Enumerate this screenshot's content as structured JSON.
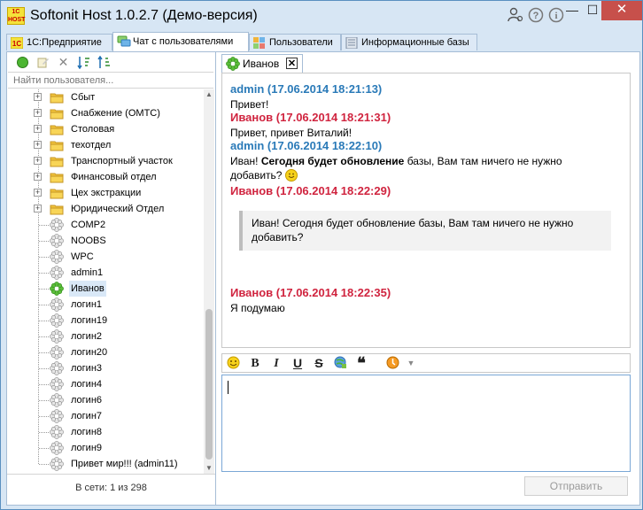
{
  "window": {
    "title": "Softonit Host 1.0.2.7 (Демо-версия)",
    "app_icon_text": "1С HOST",
    "controls": {
      "minimize": "—",
      "maximize": "☐",
      "close": "✕"
    },
    "title_buttons": [
      "user-settings-icon",
      "help-icon",
      "info-icon"
    ]
  },
  "tabs": [
    {
      "label": "1С:Предприятие",
      "icon": "1c-icon"
    },
    {
      "label": "Чат с пользователями",
      "icon": "chat-icon",
      "active": true
    },
    {
      "label": "Пользователи",
      "icon": "users-icon"
    },
    {
      "label": "Информационные базы",
      "icon": "database-icon"
    }
  ],
  "sidebar": {
    "search_placeholder": "Найти пользователя...",
    "toolbar_icons": [
      "online-status-icon",
      "edit-icon",
      "delete-icon",
      "sort-icon",
      "sort-alt-icon"
    ],
    "folders": [
      "Сбыт",
      "Снабжение (ОМТС)",
      "Столовая",
      "техотдел",
      "Транспортный участок",
      "Финансовый отдел",
      "Цех экстракции",
      "Юридический Отдел"
    ],
    "users": [
      {
        "name": "COMP2",
        "online": false
      },
      {
        "name": "NOOBS",
        "online": false
      },
      {
        "name": "WPC",
        "online": false
      },
      {
        "name": "admin1",
        "online": false
      },
      {
        "name": "Иванов",
        "online": true,
        "selected": true
      },
      {
        "name": "логин1",
        "online": false
      },
      {
        "name": "логин19",
        "online": false
      },
      {
        "name": "логин2",
        "online": false
      },
      {
        "name": "логин20",
        "online": false
      },
      {
        "name": "логин3",
        "online": false
      },
      {
        "name": "логин4",
        "online": false
      },
      {
        "name": "логин6",
        "online": false
      },
      {
        "name": "логин7",
        "online": false
      },
      {
        "name": "логин8",
        "online": false
      },
      {
        "name": "логин9",
        "online": false
      },
      {
        "name": "Привет мир!!! (admin11)",
        "online": false
      }
    ],
    "status": "В сети: 1 из 298"
  },
  "chat": {
    "tab_label": "Иванов",
    "tab_close": "✕",
    "messages": [
      {
        "header": "admin (17.06.2014 18:21:13)",
        "author": "admin",
        "text": "Привет!"
      },
      {
        "header": "Иванов (17.06.2014 18:21:31)",
        "author": "other",
        "text": "Привет, привет Виталий!"
      },
      {
        "header": "admin (17.06.2014 18:22:10)",
        "author": "admin",
        "text_prefix": "Иван! ",
        "text_bold": "Сегодня будет обновление",
        "text_suffix": " базы, Вам там ничего не нужно",
        "text_line2": "добавить?"
      },
      {
        "header": "Иванов (17.06.2014 18:22:29)",
        "author": "other",
        "quote": "Иван! Сегодня будет обновление базы, Вам там ничего не нужно добавить?"
      },
      {
        "header": "Иванов (17.06.2014 18:22:35)",
        "author": "other",
        "text": "Я подумаю"
      }
    ],
    "format_buttons": [
      {
        "name": "emoji-icon",
        "label": ""
      },
      {
        "name": "bold-button",
        "label": "B"
      },
      {
        "name": "italic-button",
        "label": "I"
      },
      {
        "name": "underline-button",
        "label": "U"
      },
      {
        "name": "strikethrough-button",
        "label": "S"
      },
      {
        "name": "insert-link-icon",
        "label": ""
      },
      {
        "name": "quote-button",
        "label": "❝"
      },
      {
        "name": "attention-icon",
        "label": ""
      }
    ],
    "input_value": "",
    "send_label": "Отправить"
  },
  "colors": {
    "admin": "#2a7ab8",
    "other": "#d0243f",
    "accent": "#d7e6f4"
  }
}
